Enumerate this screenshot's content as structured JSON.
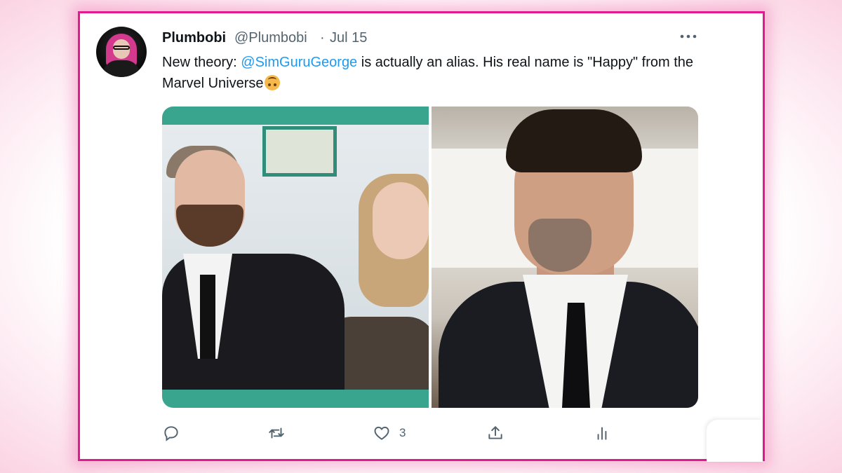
{
  "tweet": {
    "display_name": "Plumbobi",
    "handle": "@Plumbobi",
    "separator": "·",
    "date": "Jul 15",
    "text_before": "New theory: ",
    "mention": "@SimGuruGeorge",
    "text_after": " is actually an alias. His real name is \"Happy\" from the Marvel Universe",
    "emoji": "upside-down-face-emoji"
  },
  "actions": {
    "reply_icon": "reply-icon",
    "retweet_icon": "retweet-icon",
    "like_icon": "heart-icon",
    "like_count": "3",
    "share_icon": "share-icon",
    "analytics_icon": "analytics-icon"
  },
  "colors": {
    "border": "#e01a8f",
    "link": "#1d9bf0",
    "text": "#0f1419",
    "muted": "#536471"
  }
}
